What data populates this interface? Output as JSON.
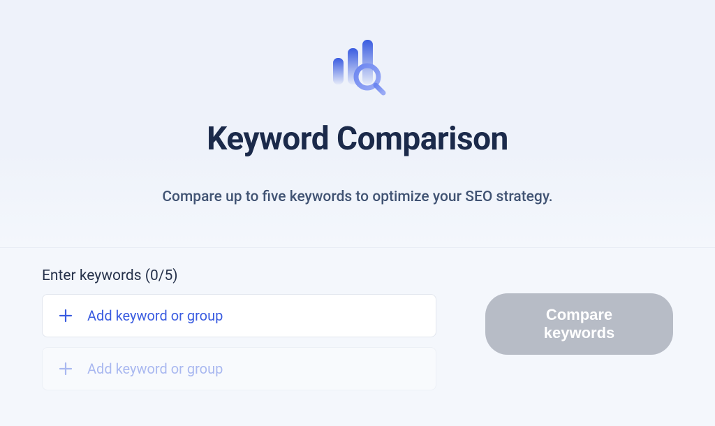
{
  "hero": {
    "title": "Keyword Comparison",
    "subtitle": "Compare up to five keywords to optimize your SEO strategy."
  },
  "form": {
    "label": "Enter keywords (0/5)",
    "inputs": [
      {
        "placeholder": "Add keyword or group"
      },
      {
        "placeholder": "Add keyword or group"
      }
    ],
    "compare_button": "Compare keywords"
  },
  "colors": {
    "accent": "#3a5ce0",
    "heading": "#1b2a4a",
    "subtext": "#415373",
    "button_disabled": "#b7bcc6"
  }
}
